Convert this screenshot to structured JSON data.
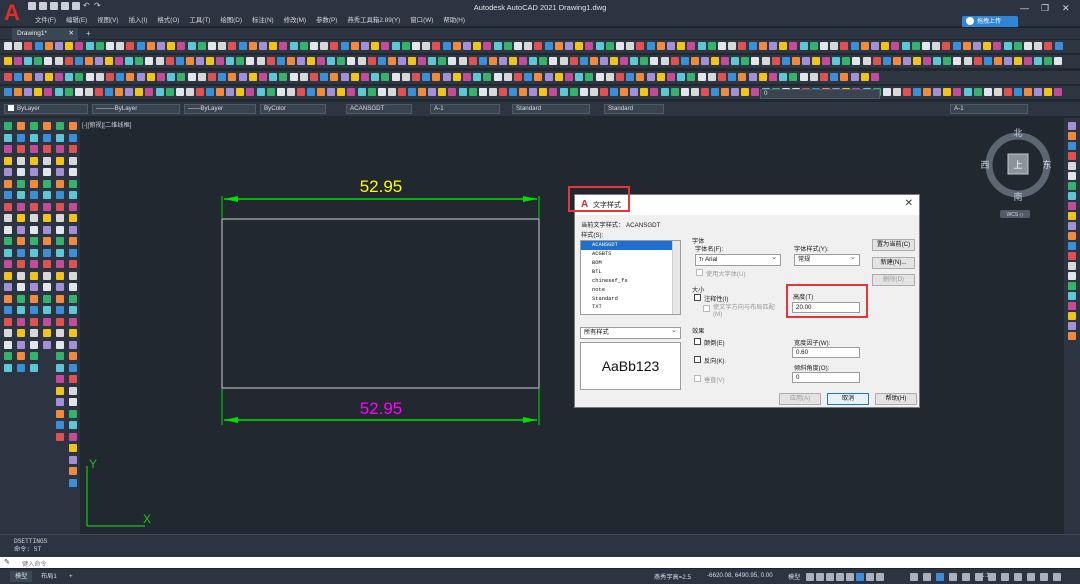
{
  "app": {
    "window_title": "Autodesk AutoCAD 2021    Drawing1.dwg",
    "menu": [
      "文件(F)",
      "编辑(E)",
      "视图(V)",
      "插入(I)",
      "格式(O)",
      "工具(T)",
      "绘图(D)",
      "标注(N)",
      "修改(M)",
      "参数(P)",
      "燕秀工具箱2.89(Y)",
      "窗口(W)",
      "帮助(H)"
    ],
    "cloud_button": "拖拽上传",
    "doc_tab": "Drawing1*"
  },
  "properties_bar": {
    "layer_color": "ByLayer",
    "linetype": "ByLayer",
    "lineweight": "ByLayer",
    "plot_color": "ByColor",
    "text_style": "ACANSGDT",
    "dim_style": "A-1",
    "table_style": "Standard",
    "mleader_style": "Standard",
    "layer_name": "0",
    "layer_state": "A-1"
  },
  "canvas": {
    "viewport_label": "[-][俯视][二维线框]",
    "dimension_top": "52.95",
    "dimension_bottom": "52.95",
    "ucs_y": "Y",
    "ucs_x": "X"
  },
  "viewcube": {
    "north": "北",
    "south": "南",
    "east": "东",
    "west": "西",
    "face": "上",
    "wcs": "WCS ◇"
  },
  "dialog": {
    "title": "文字样式",
    "current_style_label": "当前文字样式：",
    "current_style": "ACANSGDT",
    "styles_label": "样式(S):",
    "styles": [
      "ACANSGDT",
      "ACGBTS",
      "BOM",
      "BTL",
      "chinesef_fs",
      "note",
      "Standard",
      "TXT"
    ],
    "filter_value": "所有样式",
    "preview_text": "AaBb123",
    "font_group": "字体",
    "font_name_label": "字体名(F):",
    "font_name_value": "Arial",
    "font_style_label": "字体样式(Y):",
    "font_style_value": "常规",
    "big_font_label": "使用大字体(U)",
    "size_group": "大小",
    "annotative_label": "注释性(I)",
    "match_orientation_label": "使文字方向与布局匹配(M)",
    "height_label": "高度(T)",
    "height_value": "20.00",
    "effects_group": "效果",
    "upside_down_label": "颠倒(E)",
    "backwards_label": "反向(K)",
    "vertical_label": "垂直(V)",
    "width_factor_label": "宽度因子(W):",
    "width_factor_value": "0.60",
    "oblique_label": "倾斜角度(O):",
    "oblique_value": "0",
    "set_current_btn": "置为当前(C)",
    "new_btn": "新建(N)...",
    "delete_btn": "删除(D)",
    "apply_btn": "应用(A)",
    "cancel_btn": "取消",
    "help_btn": "帮助(H)"
  },
  "command": {
    "history_1": "DSETTINGS",
    "history_2": "命令: ST",
    "placeholder": "键入命令"
  },
  "status": {
    "tab_model": "模型",
    "tab_layout": "布局1",
    "text_height": "燕秀字高=2.5",
    "coords": "-6620.08, 6490.95, 0.00",
    "mode": "模型",
    "scale": "1:1"
  },
  "colors": {
    "dimension_top": "#ffff00",
    "dimension_bottom": "#ff00ff",
    "dimension_line": "#00e000",
    "highlight": "#e8343e"
  }
}
